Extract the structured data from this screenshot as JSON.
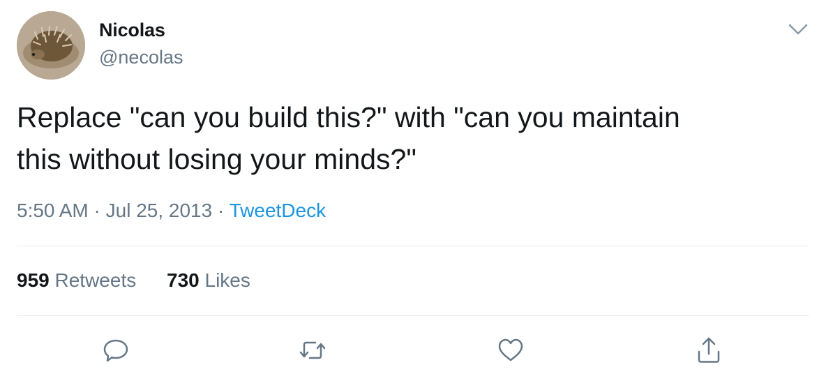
{
  "author": {
    "name": "Nicolas",
    "handle": "@necolas"
  },
  "tweet": {
    "text_line1": "Replace \"can you build this?\" with \"can you maintain",
    "text_line2": "this without losing your minds?\"",
    "time": "5:50 AM",
    "separator": "·",
    "date": "Jul 25, 2013",
    "source": "TweetDeck"
  },
  "stats": {
    "retweets_count": "959",
    "retweets_label": "Retweets",
    "likes_count": "730",
    "likes_label": "Likes"
  },
  "actions": [
    "reply-icon",
    "retweet-icon",
    "like-icon",
    "share-icon"
  ],
  "colors": {
    "text": "#14171a",
    "secondary": "#657786",
    "link": "#1b95e0",
    "divider": "#e6ecf0"
  }
}
